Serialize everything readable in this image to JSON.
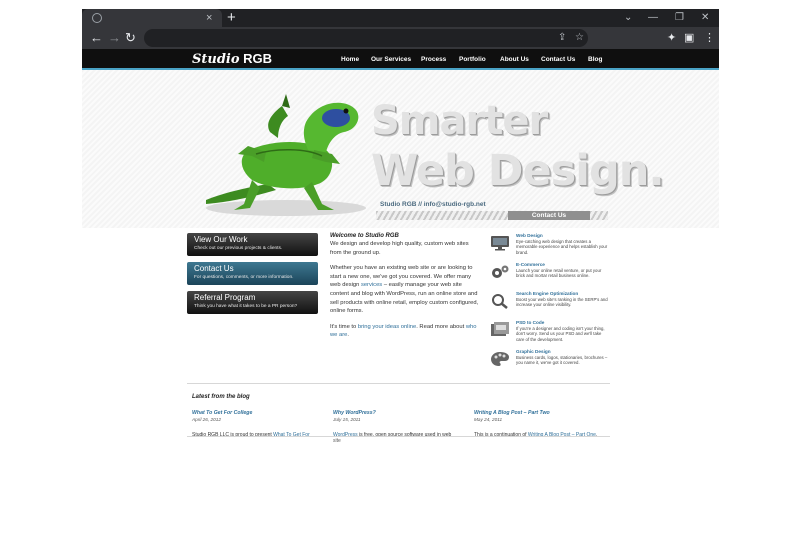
{
  "browser": {
    "tab_close_glyph": "×",
    "new_tab_glyph": "+",
    "window_controls": [
      "⌄",
      "—",
      "❐",
      "✕"
    ],
    "back_glyph": "←",
    "forward_glyph": "→",
    "reload_glyph": "↻",
    "share_glyph": "⇪",
    "star_glyph": "☆",
    "extensions_glyph": "✦",
    "sidepanel_glyph": "▣",
    "menu_glyph": "⋮"
  },
  "site": {
    "logo_studio": "Studio",
    "logo_rgb": " RGB",
    "nav": [
      "Home",
      "Our Services",
      "Process",
      "Portfolio",
      "About Us",
      "Contact Us",
      "Blog"
    ],
    "hero_line1": "Smarter",
    "hero_line2": "Web Design.",
    "contact_label": "Studio RGB",
    "contact_email": "// info@studio-rgb.net",
    "contact_tab": "Contact Us"
  },
  "sidebar": [
    {
      "title": "View Our Work",
      "sub": "Check out our previous projects & clients."
    },
    {
      "title": "Contact Us",
      "sub": "For questions, comments, or more information."
    },
    {
      "title": "Referral Program",
      "sub": "Think you have what it takes to be a PR person?"
    }
  ],
  "intro": {
    "heading": "Welcome to Studio RGB",
    "p1": "We design and develop high quality, custom web sites from the ground up.",
    "p2_a": "Whether you have an existing web site or are looking to start a new one, we've got you covered. We offer many web design ",
    "p2_link": "services",
    "p2_b": " – easily manage your web site content and blog with WordPress, run an online store and sell products with online retail, employ custom configured, online forms.",
    "p3_a": "It's time to ",
    "p3_link1": "bring your ideas online",
    "p3_b": ". Read more about ",
    "p3_link2": "who we are",
    "p3_c": "."
  },
  "services": [
    {
      "title": "Web Design",
      "desc": "Eye-catching web design that creates a memorable experience and helps establish your brand.",
      "icon": "monitor-icon"
    },
    {
      "title": "E-Commerce",
      "desc": "Launch your online retail venture, or put your brick and mortar retail business online.",
      "icon": "gears-icon"
    },
    {
      "title": "Search Engine Optimization",
      "desc": "Boost your web site's ranking in the SERP's and increase your online visibility.",
      "icon": "magnifier-icon"
    },
    {
      "title": "PSD to Code",
      "desc": "If you're a designer and coding isn't your thing, don't worry. Send us your PSD and we'll take care of the development.",
      "icon": "psd-icon"
    },
    {
      "title": "Graphic Design",
      "desc": "Business cards, logos, stationaries, brochures – you name it, we've got it covered.",
      "icon": "palette-icon"
    }
  ],
  "blog": {
    "heading": "Latest from the blog",
    "posts": [
      {
        "title": "What To Get For College",
        "date": "April 26, 2012",
        "excerpt_a": "Studio RGB LLC is proud to present ",
        "excerpt_link": "What To Get For",
        "excerpt_b": ""
      },
      {
        "title": "Why WordPress?",
        "date": "July 15, 2011",
        "excerpt_a": "",
        "excerpt_link": "WordPress",
        "excerpt_b": " is free, open source software used in web site"
      },
      {
        "title": "Writing A Blog Post – Part Two",
        "date": "May 24, 2011",
        "excerpt_a": "This is a continuation of ",
        "excerpt_link": "Writing A Blog Post – Part One",
        "excerpt_b": "."
      }
    ]
  },
  "colors": {
    "accent": "#4aa3c6",
    "link": "#2f6f99",
    "header_bg": "#0f0f0f",
    "lizard_green": "#4fae2a"
  }
}
